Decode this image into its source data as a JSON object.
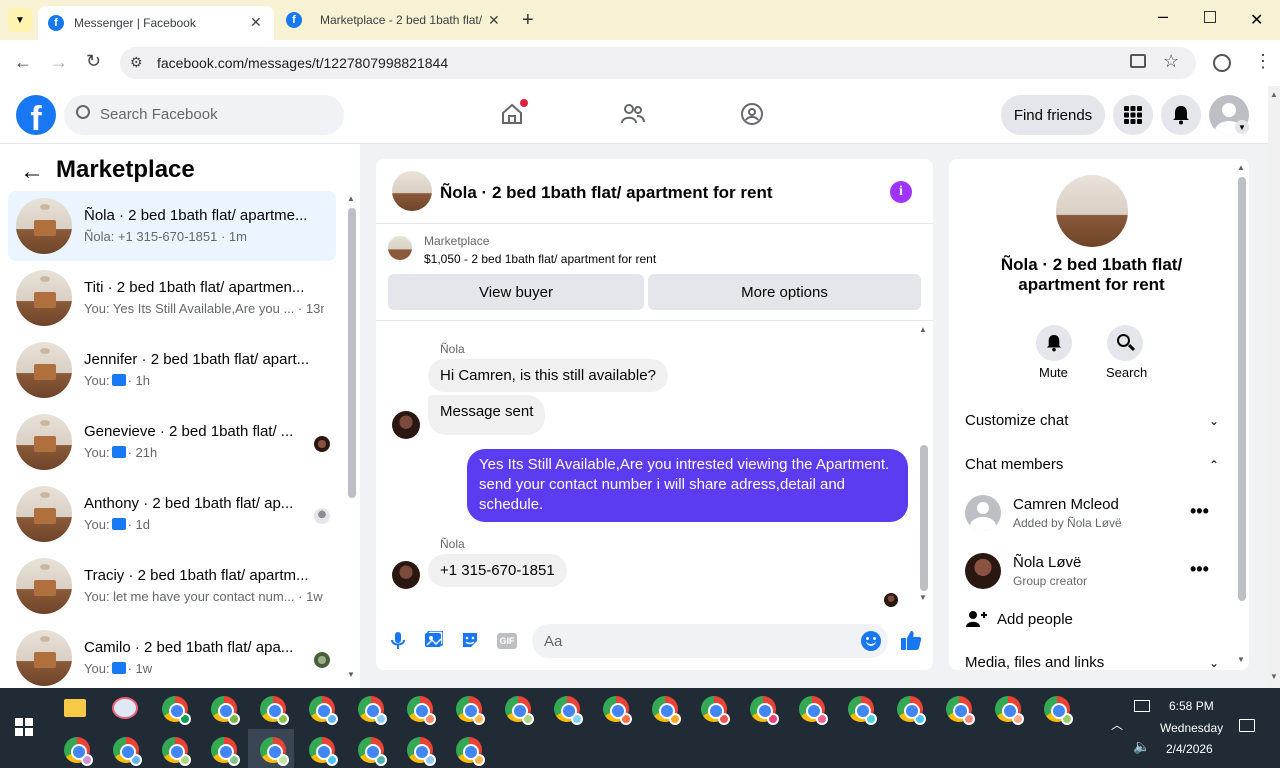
{
  "browser": {
    "tabs": [
      {
        "title": "Messenger | Facebook",
        "active": true
      },
      {
        "title": "Marketplace - 2 bed 1bath flat/",
        "active": false
      }
    ],
    "url": "facebook.com/messages/t/1227807998821844"
  },
  "header": {
    "search_placeholder": "Search Facebook",
    "find_friends": "Find friends"
  },
  "sidebar": {
    "title": "Marketplace",
    "conversations": [
      {
        "title": "Ñola · 2 bed 1bath flat/ apartme...",
        "subtitle": "Ñola: +1 315-670-1851 · 1m",
        "selected": true
      },
      {
        "title": "Titi · 2 bed 1bath flat/ apartmen...",
        "subtitle": "You: Yes Its Still Available,Are you ... · 13m"
      },
      {
        "title": "Jennifer · 2 bed 1bath flat/ apart...",
        "subtitle_prefix": "You:",
        "subtitle_suffix": "· 1h"
      },
      {
        "title": "Genevieve · 2 bed 1bath flat/ ...",
        "subtitle_prefix": "You:",
        "subtitle_suffix": "· 21h"
      },
      {
        "title": "Anthony · 2 bed 1bath flat/ ap...",
        "subtitle_prefix": "You:",
        "subtitle_suffix": "· 1d"
      },
      {
        "title": "Traciy · 2 bed 1bath flat/ apartm...",
        "subtitle": "You: let me have your contact num... · 1w"
      },
      {
        "title": "Camilo · 2 bed 1bath flat/ apa...",
        "subtitle_prefix": "You:",
        "subtitle_suffix": "· 1w"
      }
    ]
  },
  "chat": {
    "title": "Ñola · 2 bed 1bath flat/ apartment for rent",
    "listing_label": "Marketplace",
    "listing_detail": "$1,050 - 2 bed 1bath flat/ apartment for rent",
    "view_buyer": "View buyer",
    "more_options": "More options",
    "messages": [
      {
        "sender": "Ñola",
        "text": "Hi Camren, is this still available?"
      },
      {
        "text": "Message sent"
      },
      {
        "outgoing": true,
        "text": "Yes Its Still Available,Are you intrested viewing the Apartment. send your contact number i will share adress,detail and schedule."
      },
      {
        "sender": "Ñola",
        "text": "+1 315-670-1851"
      }
    ],
    "composer_placeholder": "Aa"
  },
  "info": {
    "name": "Ñola · 2 bed 1bath flat/ apartment for rent",
    "mute": "Mute",
    "search": "Search",
    "customize_chat": "Customize chat",
    "chat_members": "Chat members",
    "members": [
      {
        "name": "Camren Mcleod",
        "role": "Added by Ñola Løvë"
      },
      {
        "name": "Ñola Løvë",
        "role": "Group creator"
      }
    ],
    "add_people": "Add people",
    "media": "Media, files and links"
  },
  "taskbar": {
    "time": "6:58 PM",
    "day": "Wednesday",
    "date": "2/4/2026"
  },
  "colors": {
    "fb_blue": "#1877f2",
    "outgoing_bubble": "#5b3cf0",
    "info_icon": "#a033ff"
  }
}
